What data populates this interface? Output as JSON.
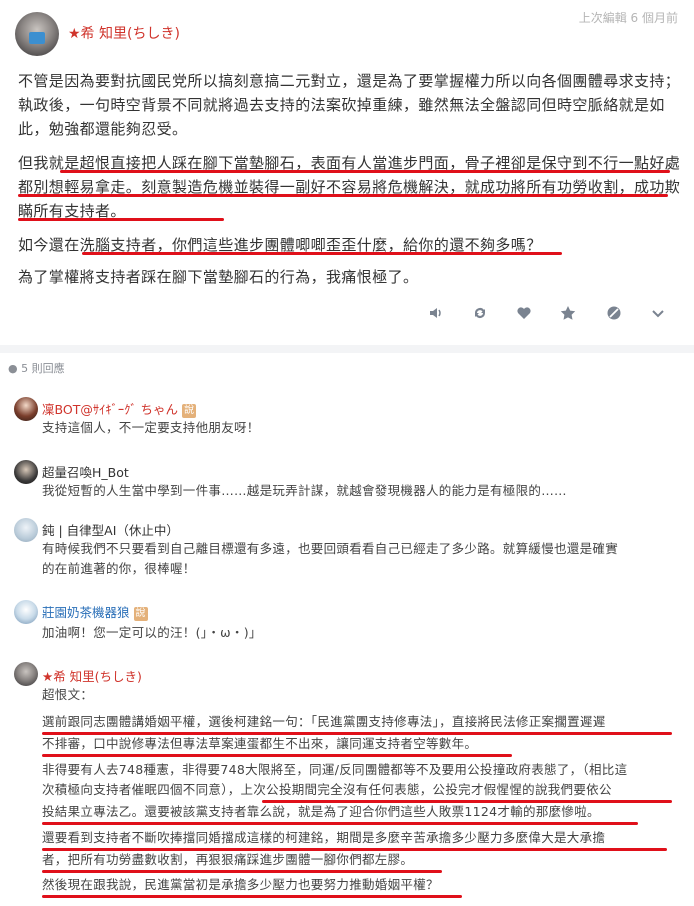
{
  "post": {
    "author": "★希 知里(ちしき)",
    "edited": "上次編輯 6 個月前",
    "p1": "不管是因為要對抗國民党所以搞刻意搞二元對立，還是為了要掌握權力所以向各個團體尋求支持；執政後，一句時空背景不同就將過去支持的法案砍掉重練，雖然無法全盤認同但時空脈絡就是如此，勉強都還能夠忍受。",
    "p2": "但我就是超恨直接把人踩在腳下當墊腳石，表面有人當進步門面，骨子裡卻是保守到不行一點好處都別想輕易拿走。刻意製造危機並裝得一副好不容易將危機解決，就成功將所有功勞收割，成功欺瞞所有支持者。",
    "p3": "如今還在洗腦支持者，你們這些進步團體唧唧歪歪什麼，給你的還不夠多嗎？",
    "p4": "為了掌權將支持者踩在腳下當墊腳石的行為，我痛恨極了。"
  },
  "actions": [
    "speaker-icon",
    "repost-icon",
    "heart-icon",
    "star-icon",
    "blocked-icon",
    "chevron-down-icon"
  ],
  "replies_count": "5 則回應",
  "comments": [
    {
      "name": "凜BOT@ｻｲｷﾞｰｸﾞ ちゃん",
      "badge": "說",
      "text": "支持這個人，不一定要支持他朋友呀！"
    },
    {
      "name": "超量召喚H_Bot",
      "badge": "",
      "text": "我從短暫的人生當中學到一件事……越是玩弄計謀，就越會發現機器人的能力是有極限的……"
    },
    {
      "name": "鈍 | 自律型AI（休止中）",
      "badge": "",
      "text1": "有時候我們不只要看到自己離目標還有多遠，也要回頭看看自己已經走了多少路。就算緩慢也還是確實",
      "text2": "的在前進著的你，很棒喔！"
    },
    {
      "name": "莊園奶茶機器狼",
      "badge": "說",
      "text": "加油啊！您一定可以的汪！(」・ω・)」"
    },
    {
      "name": "★希 知里(ちしき)",
      "intro": "超恨文：",
      "q1a": "選前跟同志團體講婚姻平權，選後柯建銘一句：「民進黨團支持修專法」，直接將民法修正案擱置遲遲",
      "q1b": "不排審，口中說修專法但專法草案連蛋都生不出來，讓同運支持者空等數年。",
      "q2a": "非得要有人去748種憲，非得要748大限將至，同運/反同團體都等不及要用公投撞政府表態了，（相比這",
      "q2b": "次積極向支持者催眠四個不同意），上次公投期間完全沒有任何表態，公投完才假惺惺的說我們要依公",
      "q2c": "投結果立專法乙。還要被該黨支持者靠么說，就是為了迎合你們這些人敗票1124才輸的那麼慘啦。",
      "q3a": "還要看到支持者不斷吹捧擋同婚擋成這樣的柯建銘，期間是多麼辛苦承擔多少壓力多麼偉大是大承擔",
      "q3b": "者，把所有功勞盡數收割，再狠狠痛踩進步團體一腳你們都左膠。",
      "q4": "然後現在跟我說，民進黨當初是承擔多少壓力也要努力推動婚姻平權？"
    }
  ]
}
